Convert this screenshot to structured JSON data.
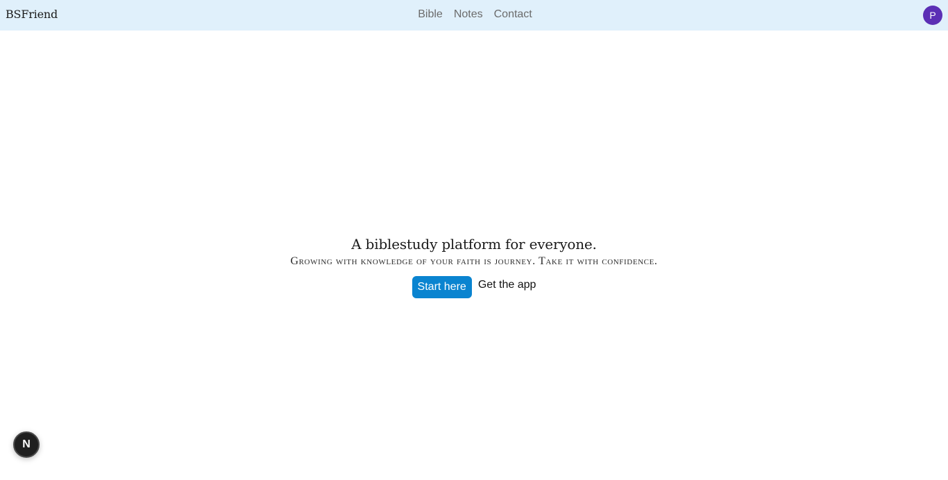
{
  "navbar": {
    "brand": "BSFriend",
    "links": [
      "Bible",
      "Notes",
      "Contact"
    ],
    "avatar_initial": "P"
  },
  "hero": {
    "title": "A biblestudy platform for everyone.",
    "subtitle": "Growing with knowledge of your faith is journey. Take it with confidence.",
    "primary_button": "Start here",
    "secondary_link": "Get the app"
  },
  "fab": {
    "letter": "N"
  },
  "colors": {
    "navbar_bg": "#e0f0fb",
    "primary": "#0a84d0",
    "avatar": "#5b2fb5"
  }
}
